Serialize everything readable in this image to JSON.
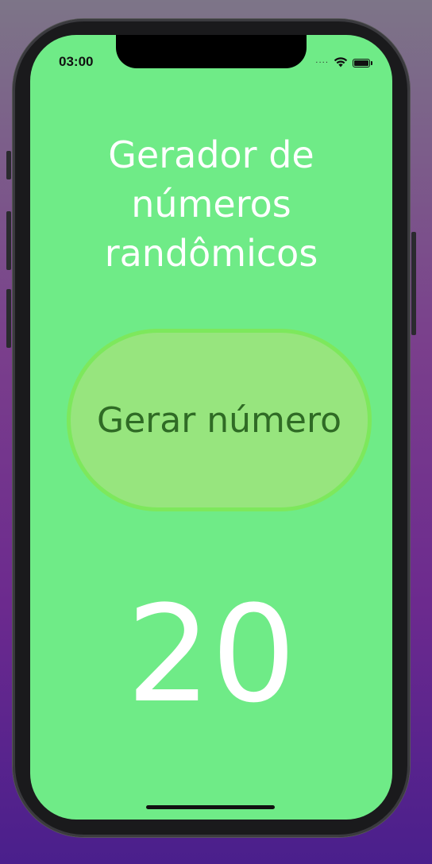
{
  "status_bar": {
    "time": "03:00",
    "signal_icon": "cellular-dots-icon",
    "wifi_icon": "wifi-icon",
    "battery_icon": "battery-icon",
    "battery_level": 1.0
  },
  "app": {
    "title": "Gerador de números randômicos",
    "button_label": "Gerar número",
    "result_number": "20"
  },
  "colors": {
    "background": "#6feb87",
    "button_fill": "#97e57e",
    "button_border": "#7de85c",
    "button_text": "#2f6b25",
    "text": "#ffffff"
  }
}
